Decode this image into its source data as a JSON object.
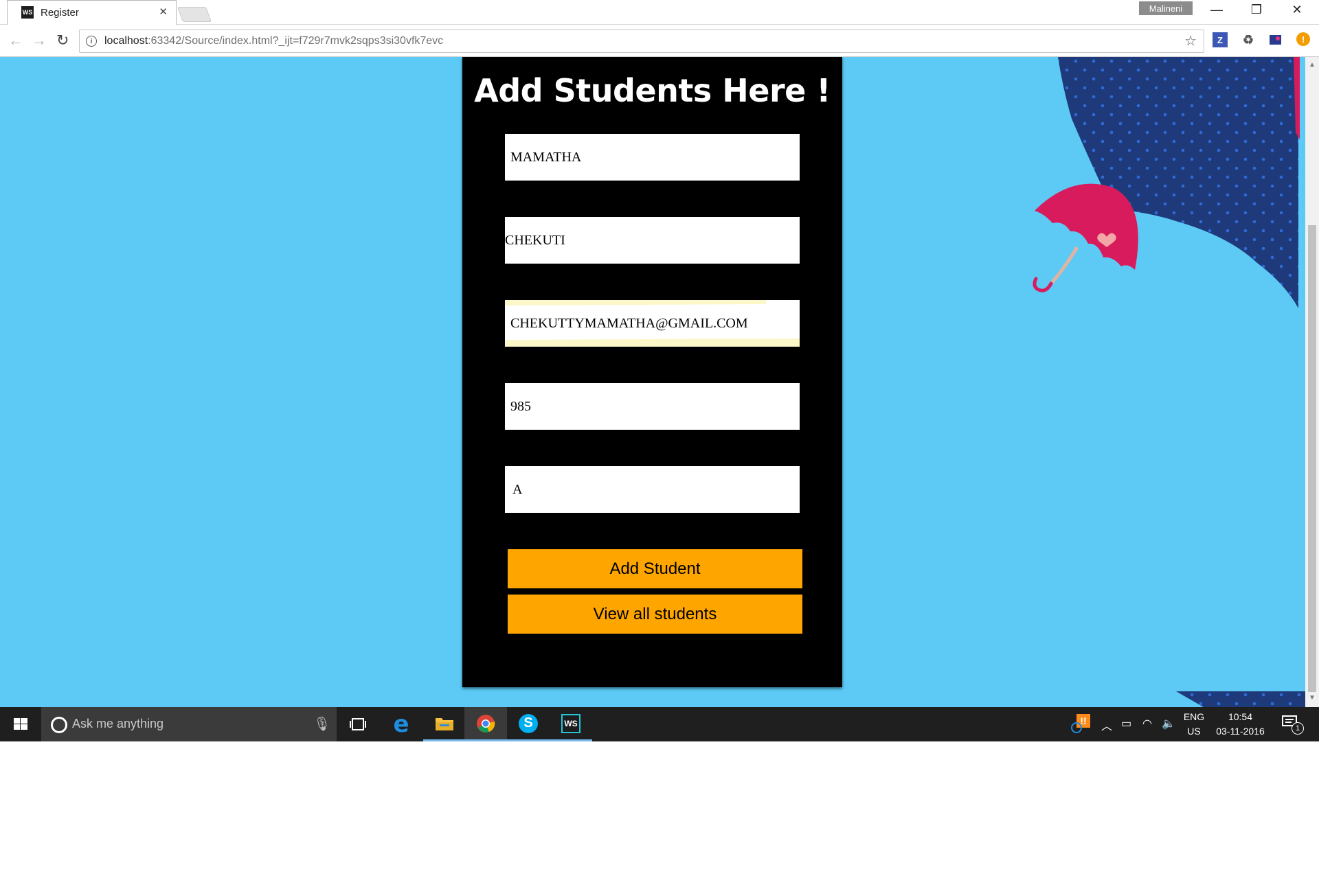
{
  "browser": {
    "tab_title": "Register",
    "tab_favicon": "WS",
    "profile_name": "Malineni",
    "url_host": "localhost",
    "url_rest": ":63342/Source/index.html?_ijt=f729r7mvk2sqps3si30vfk7evc",
    "extensions": [
      "Z"
    ]
  },
  "form": {
    "title": "Add Students Here !",
    "first_name": "MAMATHA",
    "last_name": "CHEKUTI",
    "email": "CHEKUTTYMAMATHA@GMAIL.COM",
    "phone": "985",
    "grade": "A",
    "add_button": "Add Student",
    "view_button": "View all students"
  },
  "taskbar": {
    "search_placeholder": "Ask me anything",
    "lang_primary": "ENG",
    "lang_secondary": "US",
    "time": "10:54",
    "date": "03-11-2016",
    "notification_count": "1"
  },
  "colors": {
    "page_bg": "#5ccaf5",
    "card_bg": "#000000",
    "button_bg": "#ffa500",
    "umbrella_navy": "#1f3a7a",
    "umbrella_pink": "#d81b5c"
  }
}
